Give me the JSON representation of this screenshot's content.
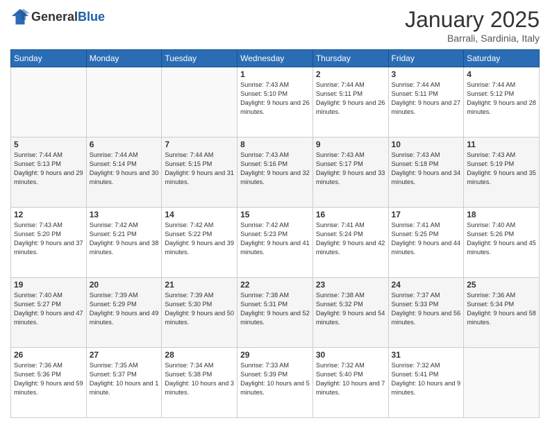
{
  "header": {
    "logo_general": "General",
    "logo_blue": "Blue",
    "month_title": "January 2025",
    "location": "Barrali, Sardinia, Italy"
  },
  "weekdays": [
    "Sunday",
    "Monday",
    "Tuesday",
    "Wednesday",
    "Thursday",
    "Friday",
    "Saturday"
  ],
  "weeks": [
    [
      {
        "day": "",
        "info": ""
      },
      {
        "day": "",
        "info": ""
      },
      {
        "day": "",
        "info": ""
      },
      {
        "day": "1",
        "info": "Sunrise: 7:43 AM\nSunset: 5:10 PM\nDaylight: 9 hours and 26 minutes."
      },
      {
        "day": "2",
        "info": "Sunrise: 7:44 AM\nSunset: 5:11 PM\nDaylight: 9 hours and 26 minutes."
      },
      {
        "day": "3",
        "info": "Sunrise: 7:44 AM\nSunset: 5:11 PM\nDaylight: 9 hours and 27 minutes."
      },
      {
        "day": "4",
        "info": "Sunrise: 7:44 AM\nSunset: 5:12 PM\nDaylight: 9 hours and 28 minutes."
      }
    ],
    [
      {
        "day": "5",
        "info": "Sunrise: 7:44 AM\nSunset: 5:13 PM\nDaylight: 9 hours and 29 minutes."
      },
      {
        "day": "6",
        "info": "Sunrise: 7:44 AM\nSunset: 5:14 PM\nDaylight: 9 hours and 30 minutes."
      },
      {
        "day": "7",
        "info": "Sunrise: 7:44 AM\nSunset: 5:15 PM\nDaylight: 9 hours and 31 minutes."
      },
      {
        "day": "8",
        "info": "Sunrise: 7:43 AM\nSunset: 5:16 PM\nDaylight: 9 hours and 32 minutes."
      },
      {
        "day": "9",
        "info": "Sunrise: 7:43 AM\nSunset: 5:17 PM\nDaylight: 9 hours and 33 minutes."
      },
      {
        "day": "10",
        "info": "Sunrise: 7:43 AM\nSunset: 5:18 PM\nDaylight: 9 hours and 34 minutes."
      },
      {
        "day": "11",
        "info": "Sunrise: 7:43 AM\nSunset: 5:19 PM\nDaylight: 9 hours and 35 minutes."
      }
    ],
    [
      {
        "day": "12",
        "info": "Sunrise: 7:43 AM\nSunset: 5:20 PM\nDaylight: 9 hours and 37 minutes."
      },
      {
        "day": "13",
        "info": "Sunrise: 7:42 AM\nSunset: 5:21 PM\nDaylight: 9 hours and 38 minutes."
      },
      {
        "day": "14",
        "info": "Sunrise: 7:42 AM\nSunset: 5:22 PM\nDaylight: 9 hours and 39 minutes."
      },
      {
        "day": "15",
        "info": "Sunrise: 7:42 AM\nSunset: 5:23 PM\nDaylight: 9 hours and 41 minutes."
      },
      {
        "day": "16",
        "info": "Sunrise: 7:41 AM\nSunset: 5:24 PM\nDaylight: 9 hours and 42 minutes."
      },
      {
        "day": "17",
        "info": "Sunrise: 7:41 AM\nSunset: 5:25 PM\nDaylight: 9 hours and 44 minutes."
      },
      {
        "day": "18",
        "info": "Sunrise: 7:40 AM\nSunset: 5:26 PM\nDaylight: 9 hours and 45 minutes."
      }
    ],
    [
      {
        "day": "19",
        "info": "Sunrise: 7:40 AM\nSunset: 5:27 PM\nDaylight: 9 hours and 47 minutes."
      },
      {
        "day": "20",
        "info": "Sunrise: 7:39 AM\nSunset: 5:29 PM\nDaylight: 9 hours and 49 minutes."
      },
      {
        "day": "21",
        "info": "Sunrise: 7:39 AM\nSunset: 5:30 PM\nDaylight: 9 hours and 50 minutes."
      },
      {
        "day": "22",
        "info": "Sunrise: 7:38 AM\nSunset: 5:31 PM\nDaylight: 9 hours and 52 minutes."
      },
      {
        "day": "23",
        "info": "Sunrise: 7:38 AM\nSunset: 5:32 PM\nDaylight: 9 hours and 54 minutes."
      },
      {
        "day": "24",
        "info": "Sunrise: 7:37 AM\nSunset: 5:33 PM\nDaylight: 9 hours and 56 minutes."
      },
      {
        "day": "25",
        "info": "Sunrise: 7:36 AM\nSunset: 5:34 PM\nDaylight: 9 hours and 58 minutes."
      }
    ],
    [
      {
        "day": "26",
        "info": "Sunrise: 7:36 AM\nSunset: 5:36 PM\nDaylight: 9 hours and 59 minutes."
      },
      {
        "day": "27",
        "info": "Sunrise: 7:35 AM\nSunset: 5:37 PM\nDaylight: 10 hours and 1 minute."
      },
      {
        "day": "28",
        "info": "Sunrise: 7:34 AM\nSunset: 5:38 PM\nDaylight: 10 hours and 3 minutes."
      },
      {
        "day": "29",
        "info": "Sunrise: 7:33 AM\nSunset: 5:39 PM\nDaylight: 10 hours and 5 minutes."
      },
      {
        "day": "30",
        "info": "Sunrise: 7:32 AM\nSunset: 5:40 PM\nDaylight: 10 hours and 7 minutes."
      },
      {
        "day": "31",
        "info": "Sunrise: 7:32 AM\nSunset: 5:41 PM\nDaylight: 10 hours and 9 minutes."
      },
      {
        "day": "",
        "info": ""
      }
    ]
  ]
}
